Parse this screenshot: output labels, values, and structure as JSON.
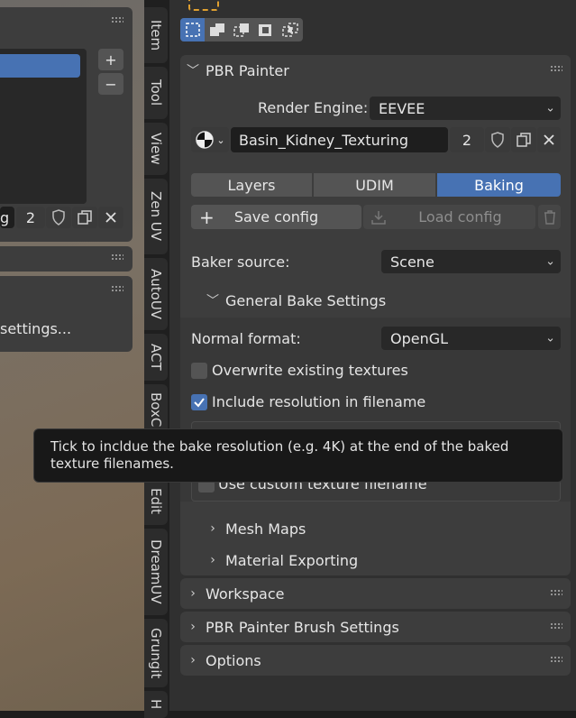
{
  "viewport": {
    "panel_field_value": "2",
    "partial_label_left": "g",
    "partial_settings": "settings...",
    "plus": "+",
    "minus": "−"
  },
  "tabs": [
    "Item",
    "Tool",
    "View",
    "Zen UV",
    "AutoUV",
    "ACT",
    "BoxC",
    "Edit",
    "DreamUV",
    "Grungit",
    "H"
  ],
  "pbr": {
    "title": "PBR Painter",
    "render_engine_label": "Render Engine:",
    "render_engine_value": "EEVEE",
    "material_name": "Basin_Kidney_Texturing",
    "user_count": "2",
    "mode_tabs": [
      "Layers",
      "UDIM",
      "Baking"
    ],
    "active_tab": "Baking",
    "save_config": "Save config",
    "load_config": "Load config",
    "baker_source_label": "Baker source:",
    "baker_source_value": "Scene",
    "general_bake_settings": "General Bake Settings",
    "normal_format_label": "Normal format:",
    "normal_format_value": "OpenGL",
    "overwrite_label": "Overwrite existing textures",
    "overwrite_checked": false,
    "include_res_label": "Include resolution in filename",
    "include_res_checked": true,
    "custom_filename_label": "Use custom texture filename",
    "mesh_maps": "Mesh Maps",
    "material_exporting": "Material Exporting"
  },
  "panels": {
    "workspace": "Workspace",
    "brush_settings": "PBR Painter Brush Settings",
    "options": "Options"
  },
  "tooltip": "Tick to incldue the bake resolution (e.g. 4K) at the end of the baked texture filenames.",
  "colors": {
    "accent": "#4772b3",
    "panel": "#3d3d3d",
    "field": "#1e1e1e",
    "button": "#545454"
  }
}
